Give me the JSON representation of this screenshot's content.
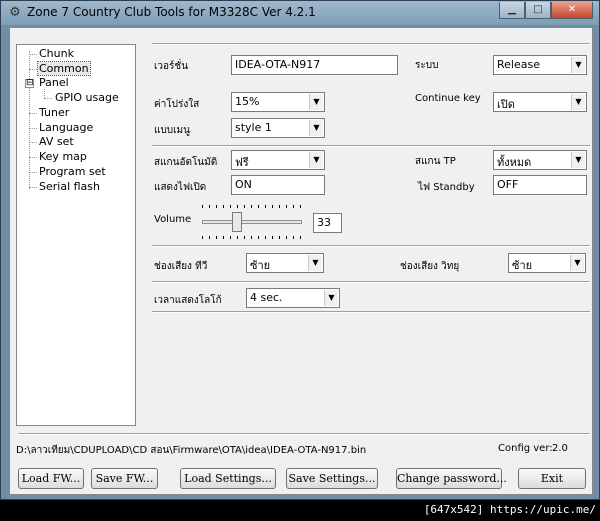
{
  "window": {
    "title": "Zone 7 Country Club Tools for M3328C  Ver 4.2.1"
  },
  "tree": {
    "items": [
      {
        "label": "Chunk"
      },
      {
        "label": "Common",
        "selected": true
      },
      {
        "label": "Panel",
        "expander": "⊟"
      },
      {
        "label": "GPIO usage"
      },
      {
        "label": "Tuner"
      },
      {
        "label": "Language"
      },
      {
        "label": "AV set"
      },
      {
        "label": "Key map"
      },
      {
        "label": "Program set"
      },
      {
        "label": "Serial flash"
      }
    ]
  },
  "form": {
    "version_label": "เวอร์ชั่น",
    "version_value": "IDEA-OTA-N917",
    "system_label": "ระบบ",
    "system_value": "Release",
    "transparency_label": "ค่าโปร่งใส",
    "transparency_value": "15%",
    "continue_key_label": "Continue key",
    "continue_key_value": "เปิด",
    "menu_style_label": "แบบเมนู",
    "menu_style_value": "style 1",
    "auto_scan_label": "สแกนอัตโนมัติ",
    "auto_scan_value": "ฟรี",
    "scan_tp_label": "สแกน TP",
    "scan_tp_value": "ทั้งหมด",
    "power_led_label": "แสดงไฟเปิด",
    "power_led_value": "ON",
    "standby_led_label": "ไฟ Standby",
    "standby_led_value": "OFF",
    "volume_label": "Volume",
    "volume_value": "33",
    "volume_fraction": 0.33,
    "tv_audio_label": "ช่องเสียง ทีวี",
    "tv_audio_value": "ซ้าย",
    "radio_audio_label": "ช่องเสียง วิทยุ",
    "radio_audio_value": "ซ้าย",
    "logo_time_label": "เวลาแสดงโลโก้",
    "logo_time_value": "4 sec."
  },
  "status": {
    "path": "D:\\ลาวเทียม\\CDUPLOAD\\CD สอน\\Firmware\\OTA\\idea\\IDEA-OTA-N917.bin",
    "config_label": "Config ver:",
    "config_value": "2.0"
  },
  "buttons": {
    "load_fw": "Load FW...",
    "save_fw": "Save FW...",
    "load_settings": "Load Settings...",
    "save_settings": "Save Settings...",
    "change_password": "Change password...",
    "exit": "Exit"
  },
  "watermark": "[647x542] https://upic.me/",
  "colors": {
    "titlebar": "#8aa7bd",
    "client": "#f0f0f0",
    "close_button": "#c8452c"
  }
}
